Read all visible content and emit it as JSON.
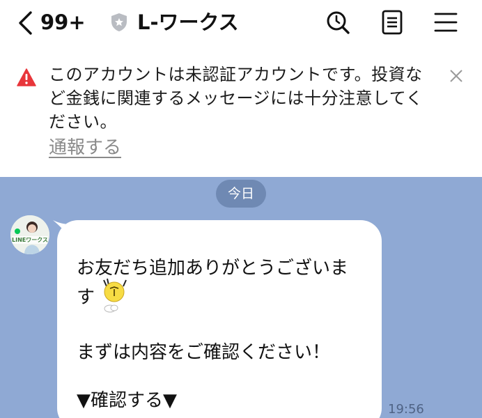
{
  "header": {
    "unread_count": "99+",
    "title": "L-ワークス",
    "icons": [
      "back-icon",
      "shield-icon",
      "search-icon",
      "notes-icon",
      "menu-icon"
    ]
  },
  "warning": {
    "lines": [
      "このアカウントは未認証アカウントです。投資な",
      "ど金銭に関連するメッセージには十分注意してく",
      "ださい。"
    ],
    "report_label": "通報する",
    "accent_color": "#e8363b"
  },
  "chat": {
    "date_label": "今日",
    "avatar_text": "LINEワークス",
    "message": {
      "line1": "お友だち追加ありがとうございま",
      "line2": "す",
      "line3": "まずは内容をご確認ください！",
      "line4": "▼確認する▼"
    },
    "time": "19:56",
    "background_color": "#8fa9d4"
  }
}
